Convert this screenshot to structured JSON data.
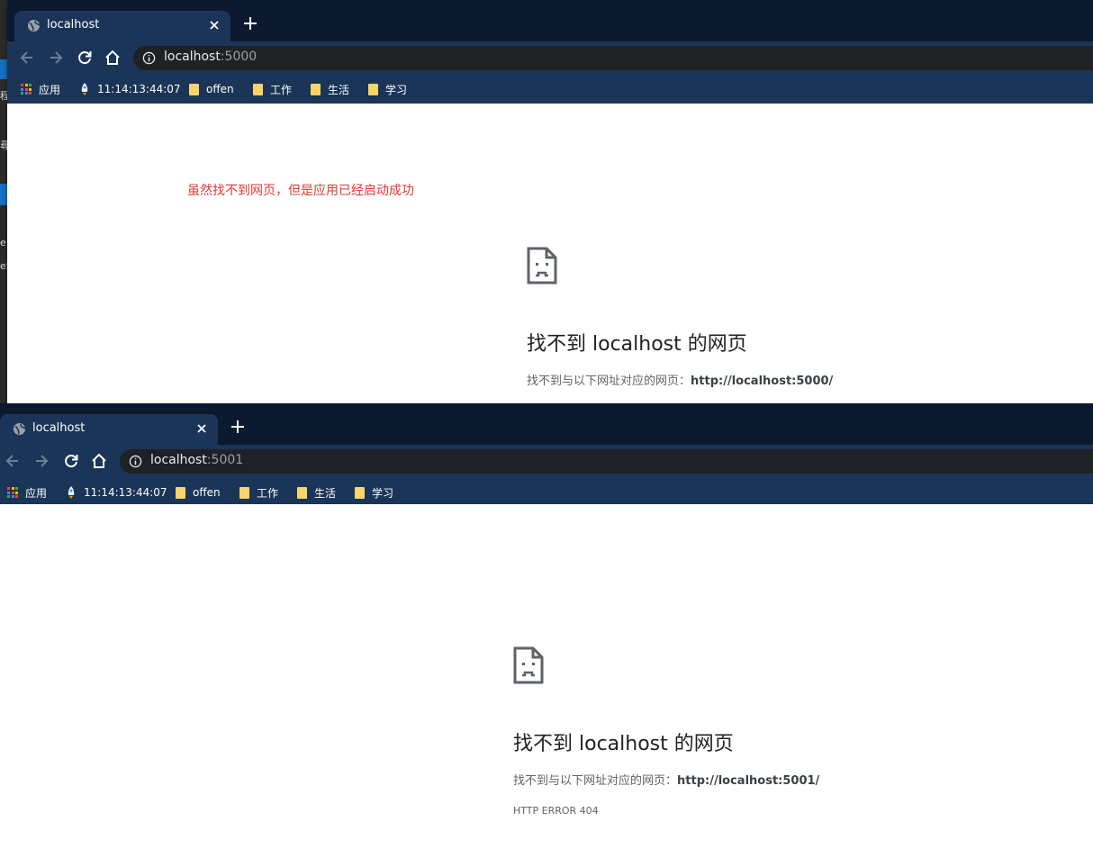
{
  "left_edge": {
    "fragments": [
      "程",
      "尋",
      "e",
      "eS"
    ]
  },
  "windows": [
    {
      "tab": {
        "title": "localhost"
      },
      "url": {
        "host": "localhost",
        "port": ":5000"
      },
      "bookmarks": [
        {
          "label": "应用",
          "icon": "apps-grid-icon"
        },
        {
          "label": "11:14:13:44:07",
          "icon": "rocket-icon"
        },
        {
          "label": "offen",
          "icon": "folder-icon"
        },
        {
          "label": "工作",
          "icon": "folder-icon"
        },
        {
          "label": "生活",
          "icon": "folder-icon"
        },
        {
          "label": "学习",
          "icon": "folder-icon"
        }
      ],
      "annotation": "虽然找不到网页，但是应用已经启动成功",
      "error": {
        "title": "找不到 localhost 的网页",
        "detail_prefix": "找不到与以下网址对应的网页：",
        "detail_url": "http://localhost:5000/"
      }
    },
    {
      "tab": {
        "title": "localhost"
      },
      "url": {
        "host": "localhost",
        "port": ":5001"
      },
      "bookmarks": [
        {
          "label": "应用",
          "icon": "apps-grid-icon"
        },
        {
          "label": "11:14:13:44:07",
          "icon": "rocket-icon"
        },
        {
          "label": "offen",
          "icon": "folder-icon"
        },
        {
          "label": "工作",
          "icon": "folder-icon"
        },
        {
          "label": "生活",
          "icon": "folder-icon"
        },
        {
          "label": "学习",
          "icon": "folder-icon"
        }
      ],
      "error": {
        "title": "找不到 localhost 的网页",
        "detail_prefix": "找不到与以下网址对应的网页：",
        "detail_url": "http://localhost:5001/",
        "code": "HTTP ERROR 404"
      }
    }
  ],
  "colors": {
    "tabstrip": "#0b1a30",
    "toolbar": "#1a3557",
    "omnibox": "#202124",
    "annotation": "#e53935",
    "folder": "#f9d46b"
  }
}
